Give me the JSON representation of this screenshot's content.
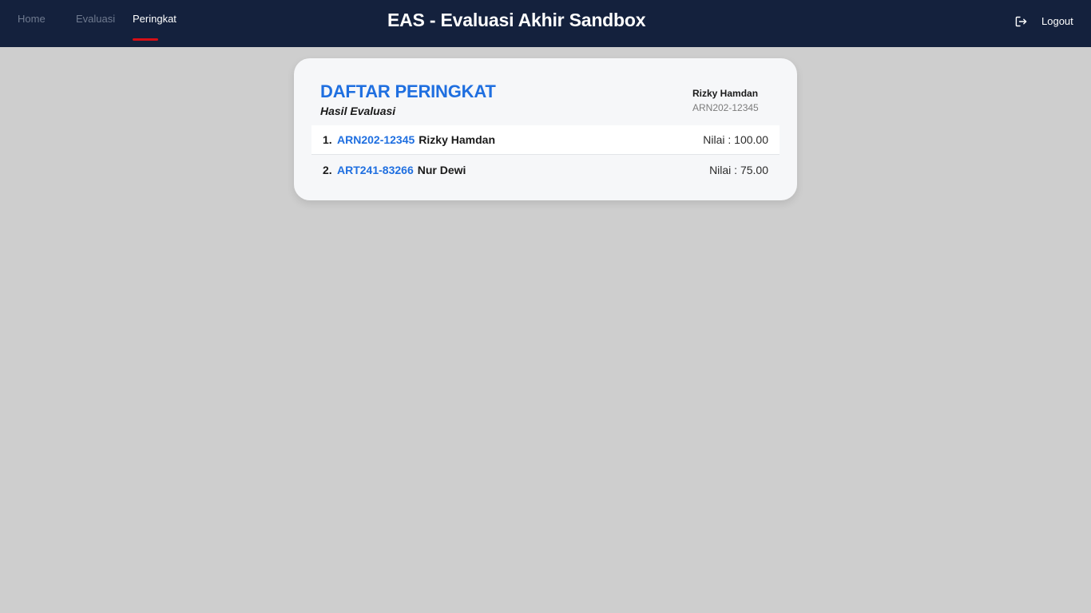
{
  "header": {
    "title": "EAS - Evaluasi Akhir Sandbox",
    "nav": [
      {
        "label": "Home"
      },
      {
        "label": "Evaluasi"
      },
      {
        "label": "Peringkat"
      }
    ],
    "active_tab": "Peringkat",
    "logout_label": "Logout",
    "logout_icon": "logout-icon"
  },
  "card": {
    "title": "DAFTAR PERINGKAT",
    "subtitle": "Hasil Evaluasi",
    "user": {
      "name": "Rizky Hamdan",
      "id": "ARN202-12345"
    },
    "rankings": [
      {
        "rank": "1.",
        "id": "ARN202-12345",
        "name": "Rizky Hamdan",
        "score": "Nilai : 100.00"
      },
      {
        "rank": "2.",
        "id": "ART241-83266",
        "name": "Nur Dewi",
        "score": "Nilai : 75.00"
      }
    ]
  },
  "colors": {
    "topbar": "#14213d",
    "accent": "#1f6fe0",
    "active_underline": "#d60f16",
    "background": "#cecece"
  }
}
